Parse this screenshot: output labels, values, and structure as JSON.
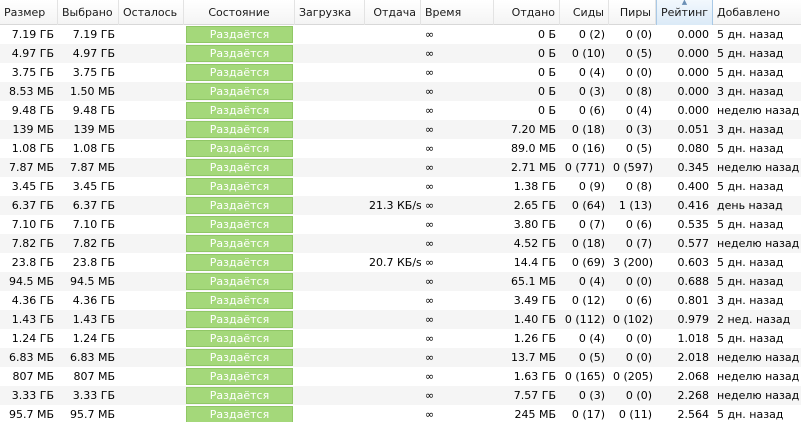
{
  "columns": {
    "size": "Размер",
    "selected": "Выбрано",
    "remaining": "Осталось",
    "status": "Состояние",
    "download": "Загрузка",
    "upload": "Отдача",
    "time": "Время",
    "uploaded": "Отдано",
    "seeds": "Сиды",
    "peers": "Пиры",
    "ratio": "Рейтинг",
    "added": "Добавлено"
  },
  "sorted_column": "ratio",
  "colors": {
    "status_fill": "#a4d87a",
    "row_alt": "#f5f5f5",
    "sorted_header": "#dbeaf7"
  },
  "rows": [
    {
      "size": "7.19 ГБ",
      "selected": "7.19 ГБ",
      "remaining": "",
      "status": "Раздаётся",
      "progress": 1.0,
      "download": "",
      "upload": "",
      "time": "∞",
      "uploaded": "0 Б",
      "seeds": "0 (2)",
      "peers": "0 (0)",
      "ratio": "0.000",
      "added": "5 дн. назад"
    },
    {
      "size": "4.97 ГБ",
      "selected": "4.97 ГБ",
      "remaining": "",
      "status": "Раздаётся",
      "progress": 1.0,
      "download": "",
      "upload": "",
      "time": "∞",
      "uploaded": "0 Б",
      "seeds": "0 (10)",
      "peers": "0 (5)",
      "ratio": "0.000",
      "added": "5 дн. назад"
    },
    {
      "size": "3.75 ГБ",
      "selected": "3.75 ГБ",
      "remaining": "",
      "status": "Раздаётся",
      "progress": 1.0,
      "download": "",
      "upload": "",
      "time": "∞",
      "uploaded": "0 Б",
      "seeds": "0 (4)",
      "peers": "0 (0)",
      "ratio": "0.000",
      "added": "5 дн. назад"
    },
    {
      "size": "8.53 МБ",
      "selected": "1.50 МБ",
      "remaining": "",
      "status": "Раздаётся",
      "progress": 1.0,
      "download": "",
      "upload": "",
      "time": "∞",
      "uploaded": "0 Б",
      "seeds": "0 (3)",
      "peers": "0 (8)",
      "ratio": "0.000",
      "added": "3 дн. назад"
    },
    {
      "size": "9.48 ГБ",
      "selected": "9.48 ГБ",
      "remaining": "",
      "status": "Раздаётся",
      "progress": 1.0,
      "download": "",
      "upload": "",
      "time": "∞",
      "uploaded": "0 Б",
      "seeds": "0 (6)",
      "peers": "0 (4)",
      "ratio": "0.000",
      "added": "неделю назад"
    },
    {
      "size": "139 МБ",
      "selected": "139 МБ",
      "remaining": "",
      "status": "Раздаётся",
      "progress": 1.0,
      "download": "",
      "upload": "",
      "time": "∞",
      "uploaded": "7.20 МБ",
      "seeds": "0 (18)",
      "peers": "0 (3)",
      "ratio": "0.051",
      "added": "3 дн. назад"
    },
    {
      "size": "1.08 ГБ",
      "selected": "1.08 ГБ",
      "remaining": "",
      "status": "Раздаётся",
      "progress": 1.0,
      "download": "",
      "upload": "",
      "time": "∞",
      "uploaded": "89.0 МБ",
      "seeds": "0 (16)",
      "peers": "0 (5)",
      "ratio": "0.080",
      "added": "5 дн. назад"
    },
    {
      "size": "7.87 МБ",
      "selected": "7.87 МБ",
      "remaining": "",
      "status": "Раздаётся",
      "progress": 1.0,
      "download": "",
      "upload": "",
      "time": "∞",
      "uploaded": "2.71 МБ",
      "seeds": "0 (771)",
      "peers": "0 (597)",
      "ratio": "0.345",
      "added": "неделю назад"
    },
    {
      "size": "3.45 ГБ",
      "selected": "3.45 ГБ",
      "remaining": "",
      "status": "Раздаётся",
      "progress": 1.0,
      "download": "",
      "upload": "",
      "time": "∞",
      "uploaded": "1.38 ГБ",
      "seeds": "0 (9)",
      "peers": "0 (8)",
      "ratio": "0.400",
      "added": "5 дн. назад"
    },
    {
      "size": "6.37 ГБ",
      "selected": "6.37 ГБ",
      "remaining": "",
      "status": "Раздаётся",
      "progress": 1.0,
      "download": "",
      "upload": "21.3 КБ/s",
      "time": "∞",
      "uploaded": "2.65 ГБ",
      "seeds": "0 (64)",
      "peers": "1 (13)",
      "ratio": "0.416",
      "added": "день назад"
    },
    {
      "size": "7.10 ГБ",
      "selected": "7.10 ГБ",
      "remaining": "",
      "status": "Раздаётся",
      "progress": 1.0,
      "download": "",
      "upload": "",
      "time": "∞",
      "uploaded": "3.80 ГБ",
      "seeds": "0 (7)",
      "peers": "0 (6)",
      "ratio": "0.535",
      "added": "5 дн. назад"
    },
    {
      "size": "7.82 ГБ",
      "selected": "7.82 ГБ",
      "remaining": "",
      "status": "Раздаётся",
      "progress": 1.0,
      "download": "",
      "upload": "",
      "time": "∞",
      "uploaded": "4.52 ГБ",
      "seeds": "0 (18)",
      "peers": "0 (7)",
      "ratio": "0.577",
      "added": "неделю назад"
    },
    {
      "size": "23.8 ГБ",
      "selected": "23.8 ГБ",
      "remaining": "",
      "status": "Раздаётся",
      "progress": 1.0,
      "download": "",
      "upload": "20.7 КБ/s",
      "time": "∞",
      "uploaded": "14.4 ГБ",
      "seeds": "0 (69)",
      "peers": "3 (200)",
      "ratio": "0.603",
      "added": "5 дн. назад"
    },
    {
      "size": "94.5 МБ",
      "selected": "94.5 МБ",
      "remaining": "",
      "status": "Раздаётся",
      "progress": 1.0,
      "download": "",
      "upload": "",
      "time": "∞",
      "uploaded": "65.1 МБ",
      "seeds": "0 (4)",
      "peers": "0 (0)",
      "ratio": "0.688",
      "added": "5 дн. назад"
    },
    {
      "size": "4.36 ГБ",
      "selected": "4.36 ГБ",
      "remaining": "",
      "status": "Раздаётся",
      "progress": 1.0,
      "download": "",
      "upload": "",
      "time": "∞",
      "uploaded": "3.49 ГБ",
      "seeds": "0 (12)",
      "peers": "0 (6)",
      "ratio": "0.801",
      "added": "3 дн. назад"
    },
    {
      "size": "1.43 ГБ",
      "selected": "1.43 ГБ",
      "remaining": "",
      "status": "Раздаётся",
      "progress": 1.0,
      "download": "",
      "upload": "",
      "time": "∞",
      "uploaded": "1.40 ГБ",
      "seeds": "0 (112)",
      "peers": "0 (102)",
      "ratio": "0.979",
      "added": "2 нед. назад"
    },
    {
      "size": "1.24 ГБ",
      "selected": "1.24 ГБ",
      "remaining": "",
      "status": "Раздаётся",
      "progress": 1.0,
      "download": "",
      "upload": "",
      "time": "∞",
      "uploaded": "1.26 ГБ",
      "seeds": "0 (4)",
      "peers": "0 (0)",
      "ratio": "1.018",
      "added": "5 дн. назад"
    },
    {
      "size": "6.83 МБ",
      "selected": "6.83 МБ",
      "remaining": "",
      "status": "Раздаётся",
      "progress": 1.0,
      "download": "",
      "upload": "",
      "time": "∞",
      "uploaded": "13.7 МБ",
      "seeds": "0 (5)",
      "peers": "0 (0)",
      "ratio": "2.018",
      "added": "неделю назад"
    },
    {
      "size": "807 МБ",
      "selected": "807 МБ",
      "remaining": "",
      "status": "Раздаётся",
      "progress": 1.0,
      "download": "",
      "upload": "",
      "time": "∞",
      "uploaded": "1.63 ГБ",
      "seeds": "0 (165)",
      "peers": "0 (205)",
      "ratio": "2.068",
      "added": "неделю назад"
    },
    {
      "size": "3.33 ГБ",
      "selected": "3.33 ГБ",
      "remaining": "",
      "status": "Раздаётся",
      "progress": 1.0,
      "download": "",
      "upload": "",
      "time": "∞",
      "uploaded": "7.57 ГБ",
      "seeds": "0 (3)",
      "peers": "0 (0)",
      "ratio": "2.268",
      "added": "неделю назад"
    },
    {
      "size": "95.7 МБ",
      "selected": "95.7 МБ",
      "remaining": "",
      "status": "Раздаётся",
      "progress": 1.0,
      "download": "",
      "upload": "",
      "time": "∞",
      "uploaded": "245 МБ",
      "seeds": "0 (17)",
      "peers": "0 (11)",
      "ratio": "2.564",
      "added": "5 дн. назад"
    }
  ]
}
